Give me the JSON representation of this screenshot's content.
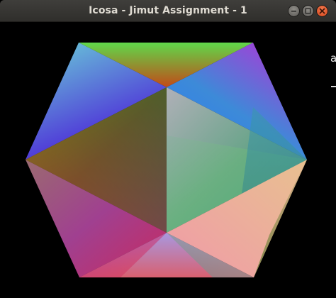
{
  "window": {
    "title": "Icosa - Jimut Assignment - 1",
    "minimize_icon": "minimize-icon",
    "maximize_icon": "maximize-icon",
    "close_icon": "close-icon"
  },
  "background_window": {
    "partial_text": "a"
  },
  "scene": {
    "background_color": "#000000"
  }
}
